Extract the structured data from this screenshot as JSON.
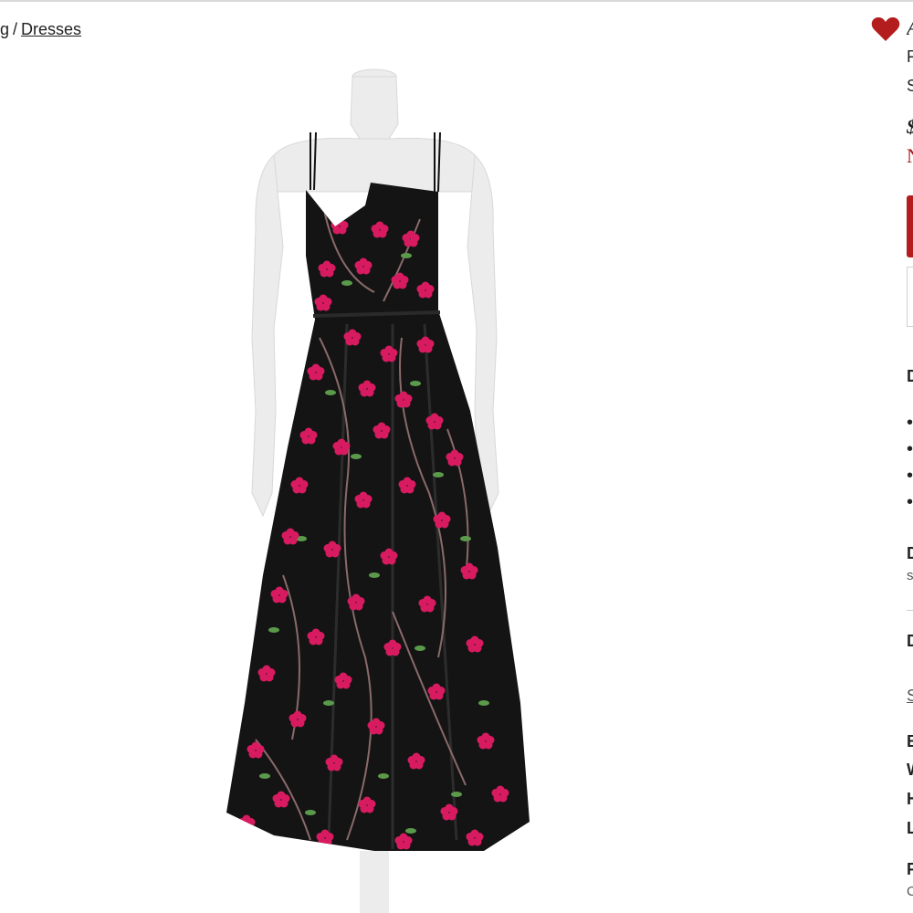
{
  "breadcrumb": {
    "partial": "g",
    "separator": "/",
    "current": "Dresses"
  },
  "product": {
    "image_alt": "Black satin floral print maxi dress with pink blossoms and spaghetti straps on mannequin",
    "colors": {
      "dress": "#141414",
      "blossom": "#d81b60",
      "leaf": "#5a9a4a",
      "branch": "#8a6a6a",
      "mannequin": "#eeeeee"
    }
  },
  "favorite": {
    "icon": "heart-icon",
    "color": "#b31d1d"
  },
  "right_panel": {
    "brand_first_char": "A",
    "line1_first_char": "F",
    "line2_first_char": "S",
    "price_first_char": "$",
    "sale_first_char": "N",
    "details_heading_first_char": "D",
    "bullets": [
      "•",
      "•",
      "•",
      "•"
    ],
    "desc_heading_first_char": "D",
    "desc_text_first_char": "s",
    "dims_heading_first_char": "D",
    "size_link_first_char": "S",
    "spec_rows": [
      "B",
      "W",
      "H",
      "L"
    ],
    "footer_heading_first_char": "F",
    "footer_text_first_char": "C"
  }
}
